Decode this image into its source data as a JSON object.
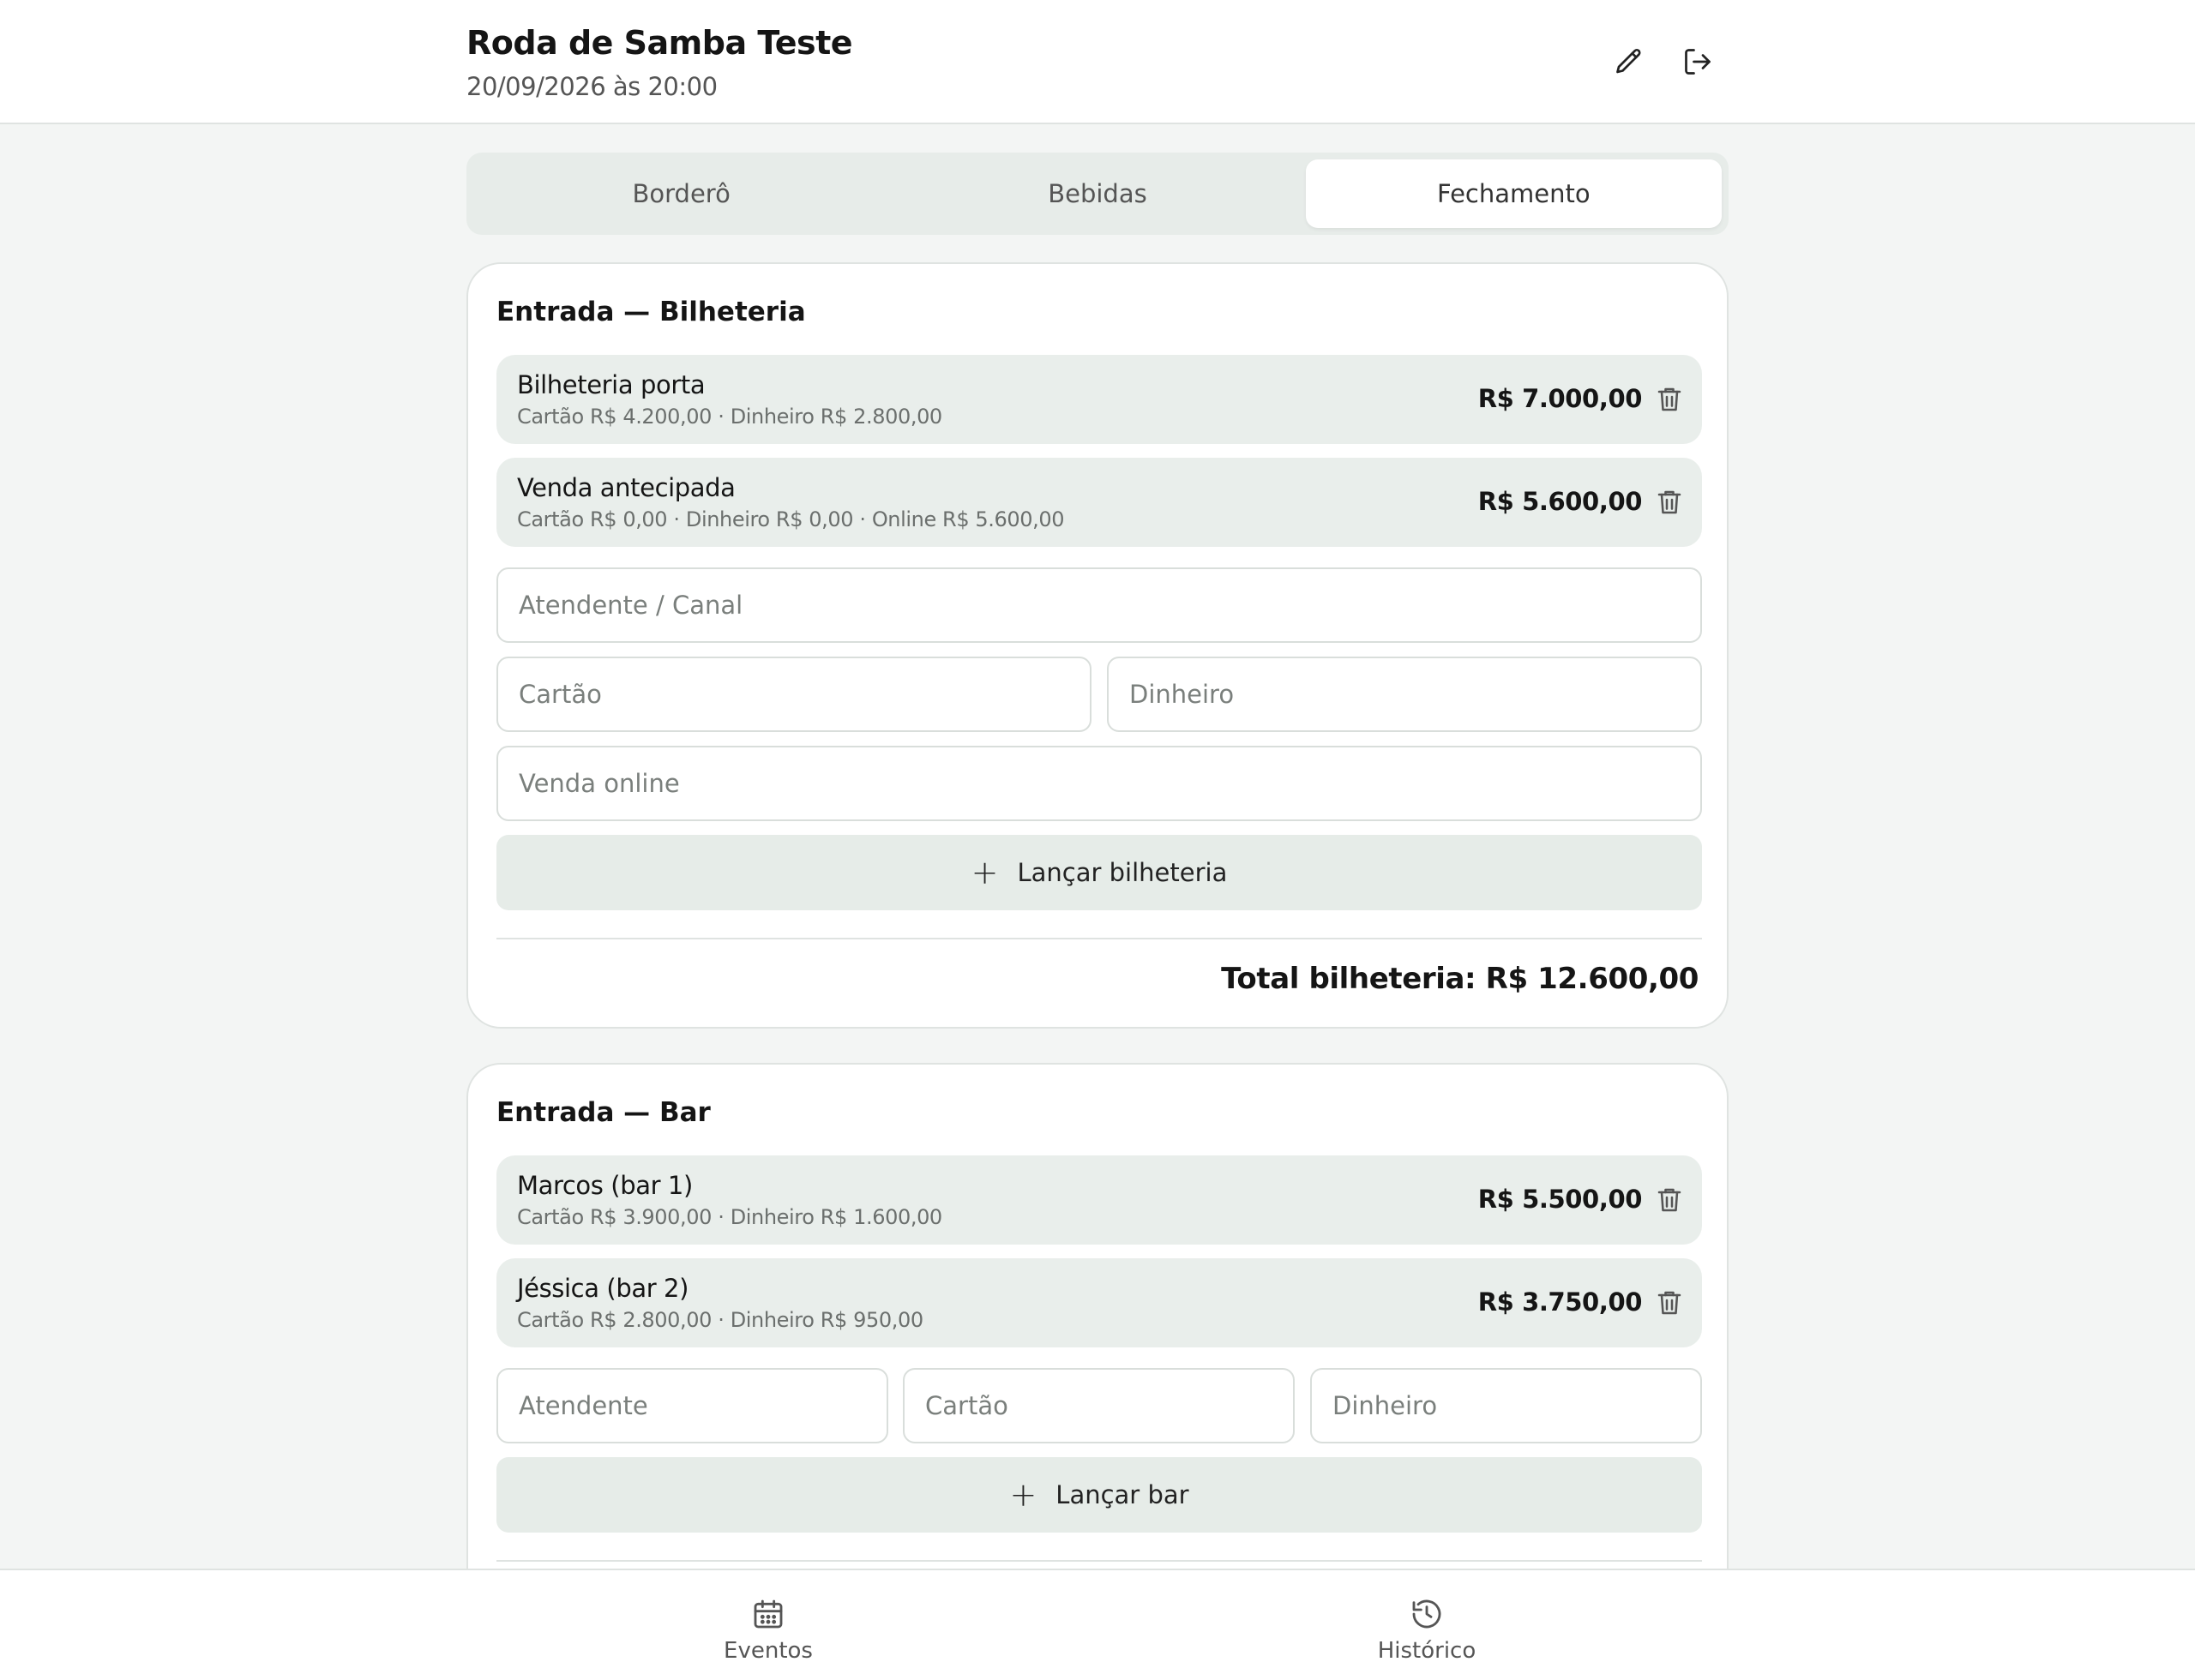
{
  "header": {
    "title": "Roda de Samba Teste",
    "subtitle": "20/09/2026 às 20:00",
    "edit_icon": "pencil-icon",
    "logout_icon": "logout-icon"
  },
  "tabs": [
    {
      "label": "Borderô",
      "active": false
    },
    {
      "label": "Bebidas",
      "active": false
    },
    {
      "label": "Fechamento",
      "active": true
    }
  ],
  "bilheteria": {
    "title": "Entrada — Bilheteria",
    "entries": [
      {
        "name": "Bilheteria porta",
        "detail": "Cartão R$ 4.200,00 · Dinheiro R$ 2.800,00",
        "amount": "R$ 7.000,00"
      },
      {
        "name": "Venda antecipada",
        "detail": "Cartão R$ 0,00 · Dinheiro R$ 0,00 · Online R$ 5.600,00",
        "amount": "R$ 5.600,00"
      }
    ],
    "placeholders": {
      "atendente": "Atendente / Canal",
      "cartao": "Cartão",
      "dinheiro": "Dinheiro",
      "online": "Venda online"
    },
    "add_label": "Lançar bilheteria",
    "total": "Total bilheteria: R$ 12.600,00"
  },
  "bar": {
    "title": "Entrada — Bar",
    "entries": [
      {
        "name": "Marcos (bar 1)",
        "detail": "Cartão R$ 3.900,00 · Dinheiro R$ 1.600,00",
        "amount": "R$ 5.500,00"
      },
      {
        "name": "Jéssica (bar 2)",
        "detail": "Cartão R$ 2.800,00 · Dinheiro R$ 950,00",
        "amount": "R$ 3.750,00"
      }
    ],
    "placeholders": {
      "atendente": "Atendente",
      "cartao": "Cartão",
      "dinheiro": "Dinheiro"
    },
    "add_label": "Lançar bar"
  },
  "bottom_nav": [
    {
      "label": "Eventos",
      "icon": "calendar-icon"
    },
    {
      "label": "Histórico",
      "icon": "history-icon"
    }
  ],
  "colors": {
    "background": "#f3f5f4",
    "entry_background": "#e9eeeb",
    "border": "#dfe3e1"
  }
}
